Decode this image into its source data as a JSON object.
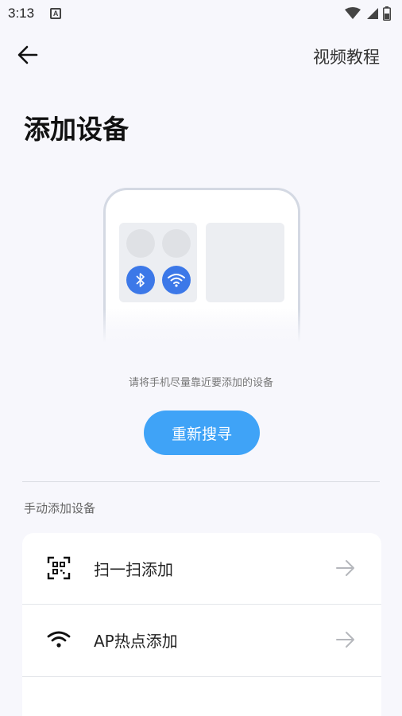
{
  "status_bar": {
    "time": "3:13",
    "notification_icon": "a-letter-icon",
    "icons": [
      "wifi-icon",
      "signal-icon",
      "battery-icon"
    ]
  },
  "header": {
    "back_icon": "back-arrow-icon",
    "video_tutorial_label": "视频教程"
  },
  "main": {
    "title": "添加设备",
    "illustration_icons": [
      "bluetooth-icon",
      "wifi-icon"
    ],
    "hint": "请将手机尽量靠近要添加的设备",
    "rescan_label": "重新搜寻"
  },
  "manual": {
    "section_label": "手动添加设备",
    "methods": [
      {
        "label": "扫一扫添加",
        "icon": "qr-scan-icon",
        "action_icon": "arrow-right-icon"
      },
      {
        "label": "AP热点添加",
        "icon": "wifi-icon",
        "action_icon": "arrow-right-icon"
      }
    ]
  },
  "colors": {
    "accent": "#3fa3f7",
    "illustration_blue": "#3c78e8",
    "background": "#f7f7fc"
  }
}
